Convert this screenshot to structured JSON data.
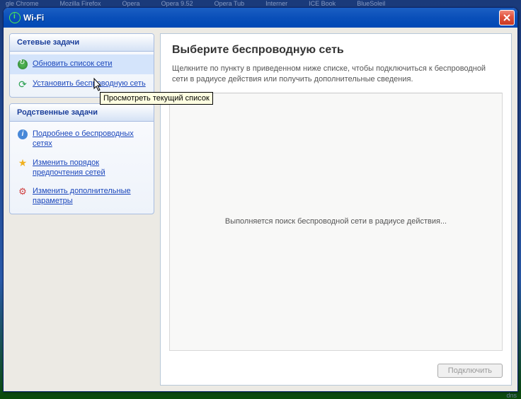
{
  "taskbar_hints": [
    "gle Chrome",
    "Mozilla Firefox",
    "Opera",
    "Opera 9.52",
    "Opera Tub",
    "Interner",
    "ICE Book",
    "BlueSoleil"
  ],
  "window": {
    "title": "Wi-Fi"
  },
  "sidebar": {
    "network_tasks": {
      "header": "Сетевые задачи",
      "items": [
        {
          "label": "Обновить список сети"
        },
        {
          "label": "Установить беспроводную сеть"
        }
      ]
    },
    "related_tasks": {
      "header": "Родственные задачи",
      "items": [
        {
          "label": "Подробнее о беспроводных сетях"
        },
        {
          "label": "Изменить порядок предпочтения сетей"
        },
        {
          "label": "Изменить дополнительные параметры"
        }
      ]
    }
  },
  "main": {
    "title": "Выберите беспроводную сеть",
    "description": "Щелкните по пункту в приведенном ниже списке, чтобы подключиться к беспроводной сети в радиусе действия или получить дополнительные сведения.",
    "searching_message": "Выполняется поиск беспроводной сети в радиусе действия...",
    "connect_button": "Подключить"
  },
  "tooltip": "Просмотреть текущий список",
  "brand": "dns"
}
